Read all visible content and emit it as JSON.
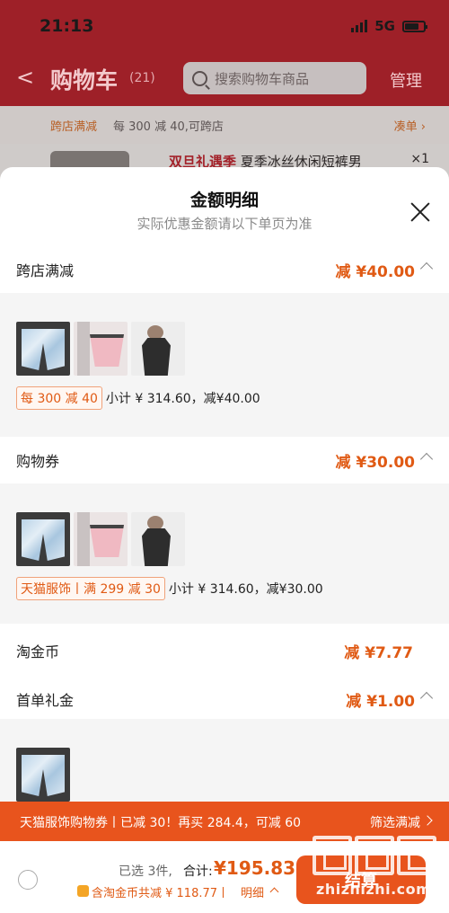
{
  "status_bar": {
    "time": "21:13",
    "network": "5G"
  },
  "header": {
    "back_label": "<",
    "title": "购物车",
    "count": "(21)",
    "search_placeholder": "搜索购物车商品",
    "manage_label": "管理"
  },
  "promo_strip": {
    "tag": "跨店满减",
    "text": "每 300 减 40,可跨店",
    "link": "凑单 ›"
  },
  "product_peek": {
    "highlight": "双旦礼遇季",
    "name": " 夏季冰丝休闲短裤男",
    "qty": "×1"
  },
  "sheet": {
    "title": "金额明细",
    "subtitle": "实际优惠金额请以下单页为准",
    "sections": [
      {
        "label": "跨店满减",
        "amount": "减 ¥40.00",
        "coupon": "每 300 减 40",
        "subtotal": "小计 ¥ 314.60，减¥40.00"
      },
      {
        "label": "购物券",
        "amount": "减 ¥30.00",
        "coupon": "天猫服饰丨满 299 减 30",
        "subtotal": "小计 ¥ 314.60，减¥30.00"
      },
      {
        "label": "淘金币",
        "amount": "减 ¥7.77"
      },
      {
        "label": "首单礼金",
        "amount": "减 ¥1.00"
      }
    ]
  },
  "deal_banner": {
    "text": "天猫服饰购物券丨已减 30！再买 284.4，可减 60",
    "link": "筛选满减"
  },
  "checkout": {
    "selected": "已选 3件,",
    "total_label": "合计:",
    "total_value": "¥195.83",
    "discount": "含淘金币共减 ¥ 118.77丨",
    "detail_link": "明细",
    "settle_label": "结算"
  },
  "watermark": {
    "text": "zhizhizhi.com"
  },
  "colors": {
    "accent": "#e05a14",
    "header": "#9e2028",
    "banner": "#e8541d"
  }
}
